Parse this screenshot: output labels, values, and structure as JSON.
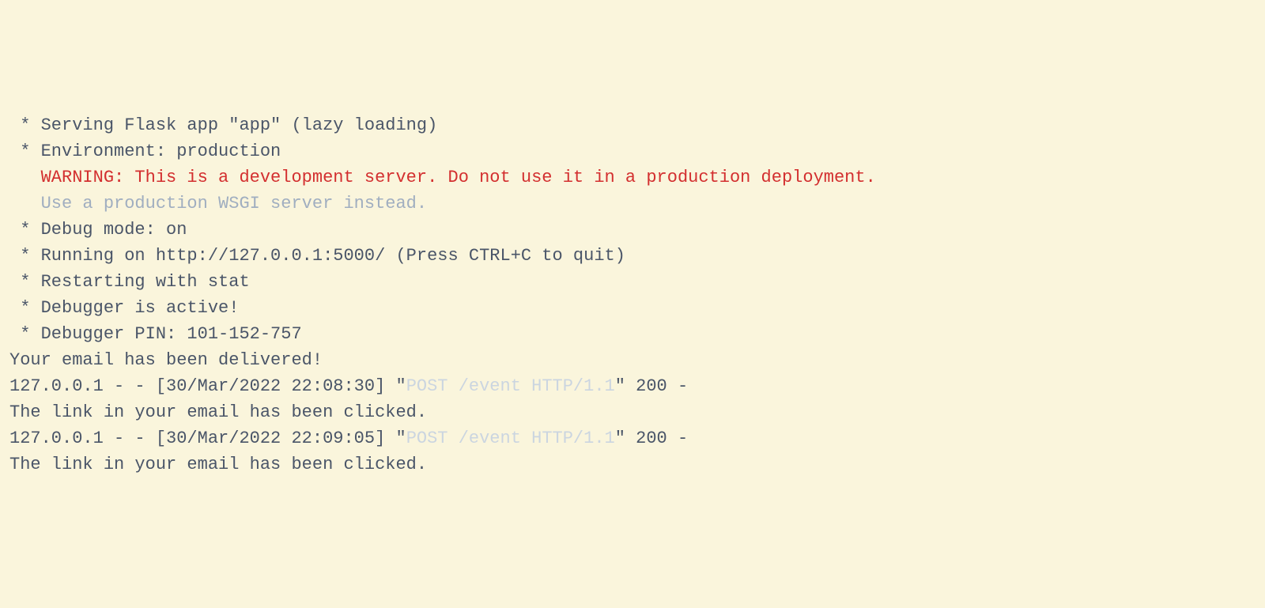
{
  "lines": {
    "l1": " * Serving Flask app \"app\" (lazy loading)",
    "l2": " * Environment: production",
    "l3": "   WARNING: This is a development server. Do not use it in a production deployment.",
    "l4": "   Use a production WSGI server instead.",
    "l5": " * Debug mode: on",
    "l6": " * Running on http://127.0.0.1:5000/ (Press CTRL+C to quit)",
    "l7": " * Restarting with stat",
    "l8": " * Debugger is active!",
    "l9": " * Debugger PIN: 101-152-757",
    "l10": "Your email has been delivered!",
    "l11a": "127.0.0.1 - - [30/Mar/2022 22:08:30] \"",
    "l11b": "POST /event HTTP/1.1",
    "l11c": "\" 200 -",
    "l12": "The link in your email has been clicked.",
    "l13a": "127.0.0.1 - - [30/Mar/2022 22:09:05] \"",
    "l13b": "POST /event HTTP/1.1",
    "l13c": "\" 200 -",
    "l14": "The link in your email has been clicked."
  }
}
